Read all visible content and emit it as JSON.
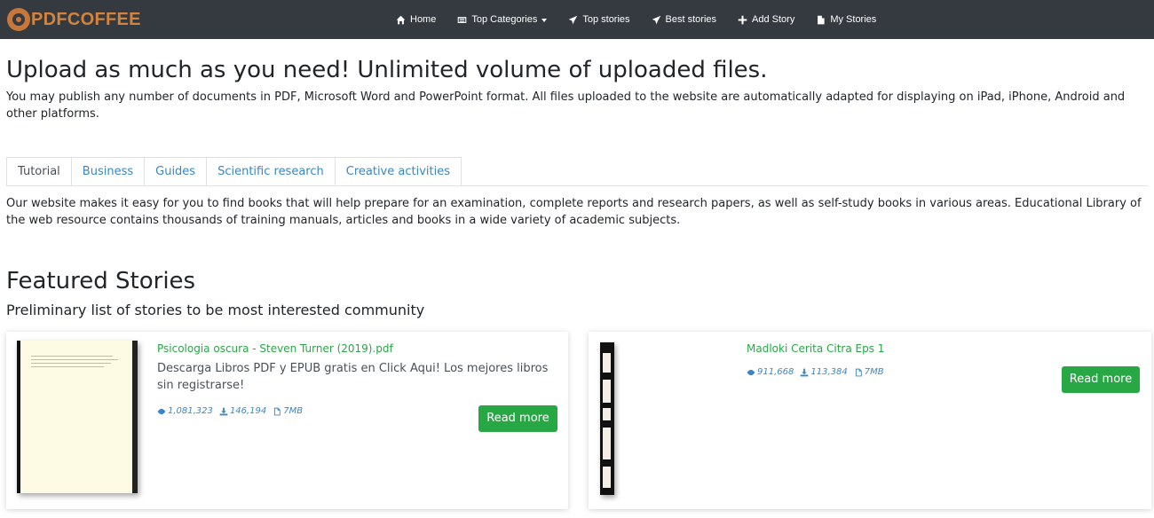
{
  "brand": {
    "name": "PDFCOFFEE",
    "color": "#d2843f"
  },
  "nav": {
    "home": "Home",
    "top_categories": "Top Categories",
    "top_stories": "Top stories",
    "best_stories": "Best stories",
    "add_story": "Add Story",
    "my_stories": "My Stories"
  },
  "hero": {
    "title": "Upload as much as you need! Unlimited volume of uploaded files.",
    "text": "You may publish any number of documents in PDF, Microsoft Word and PowerPoint format. All files uploaded to the website are automatically adapted for displaying on iPad, iPhone, Android and other platforms."
  },
  "tabs": [
    {
      "label": "Tutorial",
      "active": true
    },
    {
      "label": "Business",
      "active": false
    },
    {
      "label": "Guides",
      "active": false
    },
    {
      "label": "Scientific research",
      "active": false
    },
    {
      "label": "Creative activities",
      "active": false
    }
  ],
  "tab_content": "Our website makes it easy for you to find books that will help prepare for an examination, complete reports and research papers, as well as self-study books in various areas. Educational Library of the web resource contains thousands of training manuals, articles and books in a wide variety of academic subjects.",
  "featured": {
    "title": "Featured Stories",
    "subtitle": "Preliminary list of stories to be most interested community",
    "cards": [
      {
        "title": "Psicologia oscura - Steven Turner (2019).pdf",
        "description": "Descarga Libros PDF y EPUB gratis en Click Aqui! Los mejores libros sin registrarse!",
        "views": "1,081,323",
        "downloads": "146,194",
        "size": "7MB",
        "button": "Read more"
      },
      {
        "title": "Madloki Cerita Citra Eps 1",
        "description": "",
        "views": "911,668",
        "downloads": "113,384",
        "size": "7MB",
        "button": "Read more"
      }
    ]
  },
  "colors": {
    "accent_green": "#28a745",
    "link_blue": "#3a86c7",
    "navbar": "#343a40"
  }
}
